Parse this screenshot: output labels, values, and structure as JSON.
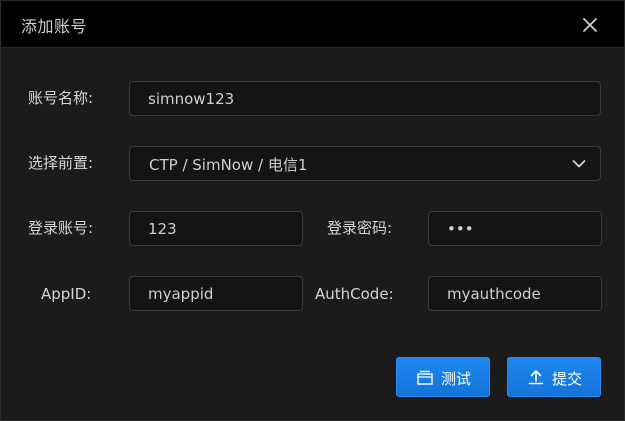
{
  "dialog": {
    "title": "添加账号",
    "close_icon": "close-icon"
  },
  "form": {
    "account_name": {
      "label": "账号名称:",
      "value": "simnow123"
    },
    "frontend": {
      "label": "选择前置:",
      "selected": "CTP / SimNow / 电信1",
      "icon": "chevron-down-icon"
    },
    "login_account": {
      "label": "登录账号:",
      "value": "123"
    },
    "login_password": {
      "label": "登录密码:",
      "value": "•••"
    },
    "app_id": {
      "label": "AppID:",
      "value": "myappid"
    },
    "auth_code": {
      "label": "AuthCode:",
      "value": "myauthcode"
    }
  },
  "buttons": {
    "test": {
      "label": "测试",
      "icon": "window-icon"
    },
    "submit": {
      "label": "提交",
      "icon": "upload-icon"
    }
  },
  "colors": {
    "accent": "#1a7ee6",
    "background": "#1b1b1b",
    "titlebar": "#000000",
    "field_border": "#3a3a3a"
  }
}
